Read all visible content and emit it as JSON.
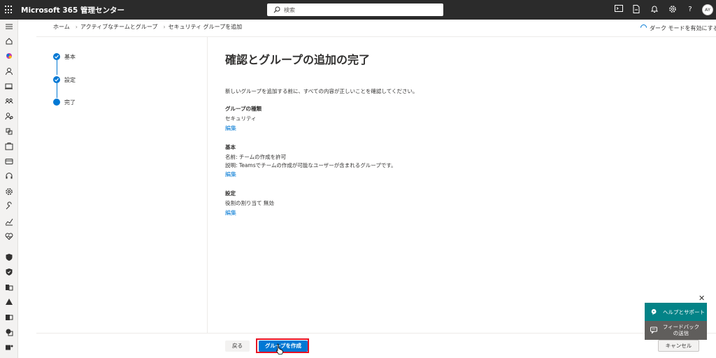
{
  "topbar": {
    "app_title": "Microsoft 365 管理センター",
    "search_placeholder": "検索",
    "avatar_initials": "AY"
  },
  "breadcrumb": [
    "ホーム",
    "アクティブなチームとグループ",
    "セキュリティ グループを追加"
  ],
  "darkmode_label": "ダーク モードを有効にする",
  "steps": [
    {
      "label": "基本",
      "state": "done"
    },
    {
      "label": "設定",
      "state": "done"
    },
    {
      "label": "完了",
      "state": "current"
    }
  ],
  "main": {
    "title": "確認とグループの追加の完了",
    "description": "新しいグループを追加する前に、すべての内容が正しいことを確認してください。",
    "sections": [
      {
        "heading": "グループの種類",
        "lines": [
          "セキュリティ"
        ],
        "edit": "編集"
      },
      {
        "heading": "基本",
        "lines": [
          "名前: チームの作成を許可",
          "説明: Teamsでチームの作成が可能なユーザーが含まれるグループです。"
        ],
        "edit": "編集"
      },
      {
        "heading": "設定",
        "lines": [
          "役割の割り当て 無効"
        ],
        "edit": "編集"
      }
    ]
  },
  "footer": {
    "back_label": "戻る",
    "create_label": "グループを作成",
    "cancel_label": "キャンセル"
  },
  "help_panel": {
    "help_label": "ヘルプとサポート",
    "feedback_label": "フィードバック\nの送信"
  },
  "colors": {
    "topbar": "#2b2b2b",
    "accent": "#0078d4",
    "help": "#038387",
    "feedback": "#605e5c",
    "highlight": "#e81123"
  }
}
